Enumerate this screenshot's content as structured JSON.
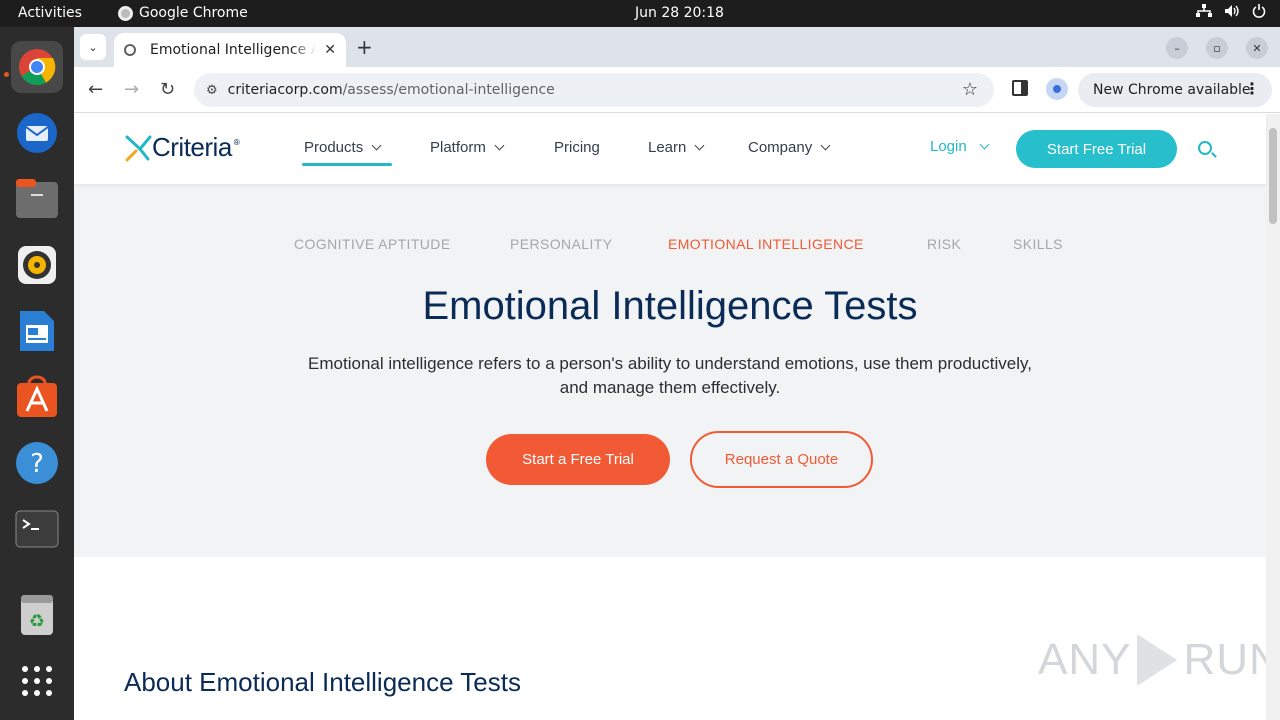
{
  "topbar": {
    "activities": "Activities",
    "app_name": "Google Chrome",
    "clock": "Jun 28  20:18"
  },
  "dock": {
    "items": [
      "chrome",
      "thunderbird",
      "files",
      "rhythmbox",
      "libreoffice-writer",
      "app-center",
      "help",
      "terminal",
      "trash",
      "show-apps"
    ]
  },
  "browser": {
    "tab_title": "Emotional Intelligence A",
    "url_domain": "criteriacorp.com",
    "url_path": "/assess/emotional-intelligence",
    "update_label": "New Chrome available"
  },
  "site": {
    "logo_text": "Criteria",
    "logo_reg": "®",
    "nav": [
      {
        "label": "Products"
      },
      {
        "label": "Platform"
      },
      {
        "label": "Pricing"
      },
      {
        "label": "Learn"
      },
      {
        "label": "Company"
      }
    ],
    "login": "Login",
    "start_trial": "Start Free Trial"
  },
  "hero": {
    "tabs": [
      "COGNITIVE APTITUDE",
      "PERSONALITY",
      "EMOTIONAL INTELLIGENCE",
      "RISK",
      "SKILLS"
    ],
    "active_tab": "EMOTIONAL INTELLIGENCE",
    "title": "Emotional Intelligence Tests",
    "description_line1": "Emotional intelligence refers to a person's ability to understand emotions, use them productively,",
    "description_line2": "and manage them effectively.",
    "primary_button": "Start a Free Trial",
    "secondary_button": "Request a Quote"
  },
  "about": {
    "title": "About Emotional Intelligence Tests"
  },
  "watermark": {
    "left": "ANY",
    "right": "RUN"
  },
  "colors": {
    "teal": "#26bfcb",
    "orange": "#f15a35",
    "navy": "#0b2b57",
    "hero_bg": "#f2f3f5"
  }
}
